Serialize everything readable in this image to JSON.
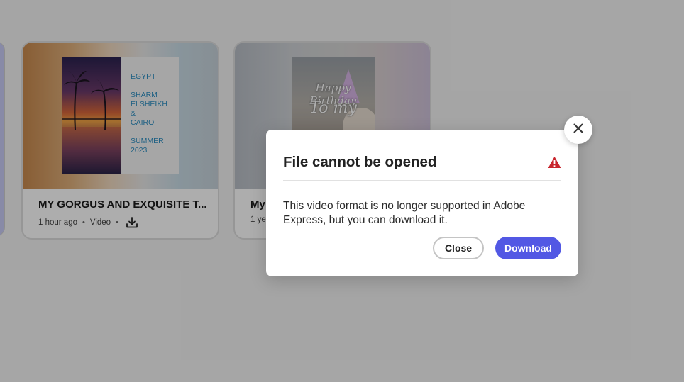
{
  "cards": [
    {
      "title": "MY GORGUS AND EXQUISITE T...",
      "time": "1 hour ago",
      "type": "Video",
      "dot": "•",
      "thumbnail": {
        "lines": [
          "EGYPT",
          "SHARM",
          "ELSHEIKH",
          "&",
          "CAIRO",
          "SUMMER",
          "2023"
        ]
      }
    },
    {
      "title": "My",
      "time": "1 yea",
      "thumbnail": {
        "line1": "Happy Birthday",
        "line2": "To my"
      }
    }
  ],
  "dialog": {
    "title": "File cannot be opened",
    "message": "This video format is no longer supported in Adobe Express, but you can download it.",
    "close_label": "Close",
    "download_label": "Download",
    "alert_icon": "alert-triangle-icon",
    "dismiss_icon": "close-icon"
  },
  "colors": {
    "primary_button": "#5258e4",
    "alert": "#c9252d",
    "overlay": "rgba(0,0,0,0.32)"
  }
}
